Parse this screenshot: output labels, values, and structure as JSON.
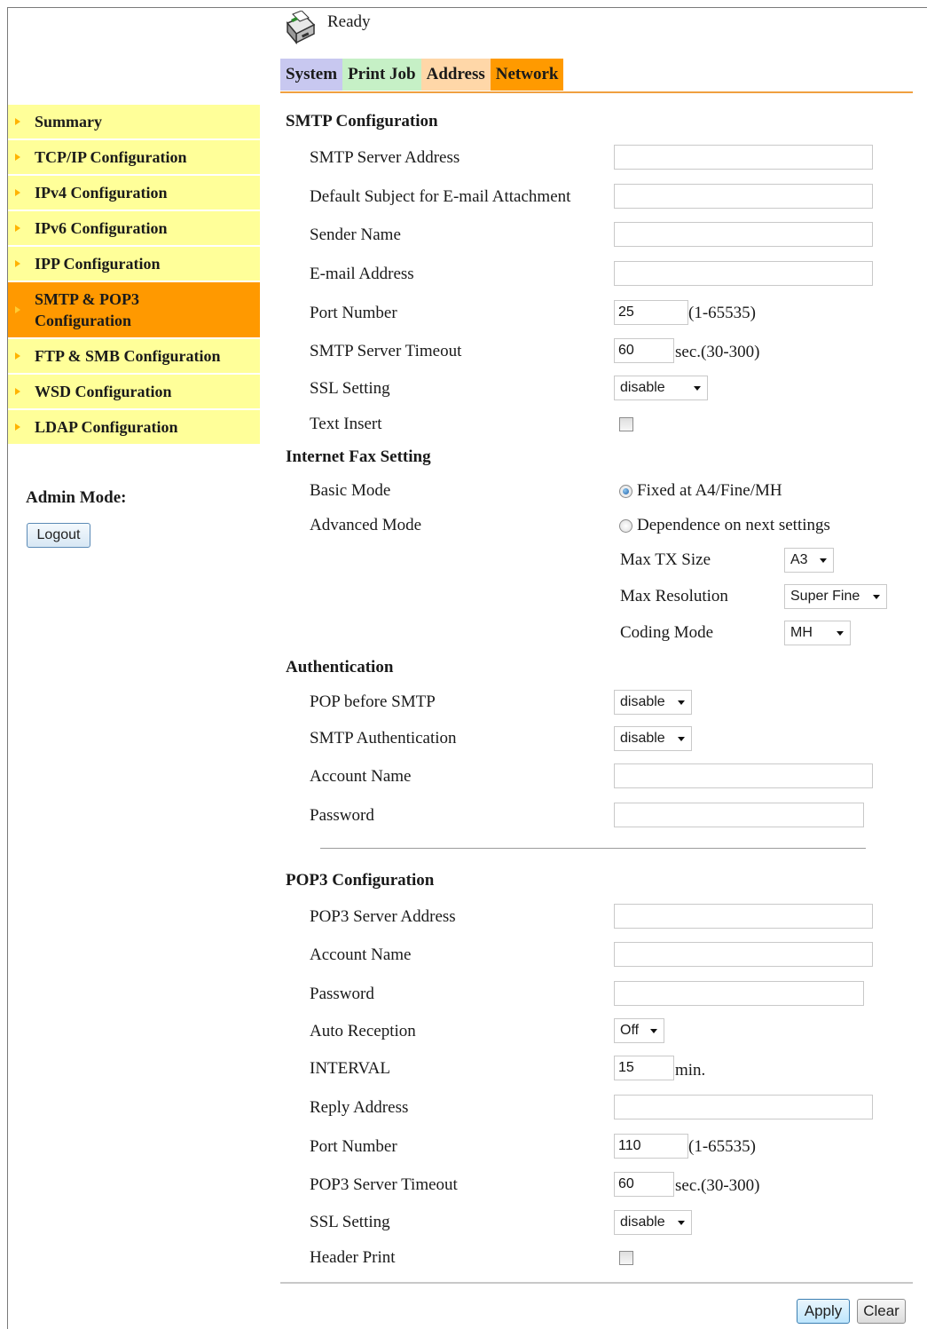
{
  "header": {
    "printer_icon": "printer-icon",
    "status": "Ready",
    "tabs": [
      "System",
      "Print Job",
      "Address",
      "Network"
    ],
    "active_tab": "Network",
    "colors": {
      "system": "#c8c8f0",
      "print_job": "#c6f0c6",
      "address": "#ffd7a8",
      "network": "#ff9a00"
    }
  },
  "sidebar": {
    "items": [
      {
        "label": "Summary"
      },
      {
        "label": "TCP/IP Configuration"
      },
      {
        "label": "IPv4 Configuration"
      },
      {
        "label": "IPv6 Configuration"
      },
      {
        "label": "IPP Configuration"
      },
      {
        "label": "SMTP & POP3 Configuration",
        "active": true
      },
      {
        "label": "FTP & SMB Configuration"
      },
      {
        "label": "WSD Configuration"
      },
      {
        "label": "LDAP Configuration"
      }
    ],
    "admin_label": "Admin Mode:",
    "logout_label": "Logout"
  },
  "smtp": {
    "title": "SMTP Configuration",
    "server_address_label": "SMTP Server Address",
    "server_address_value": "",
    "default_subject_label": "Default Subject for E-mail Attachment",
    "default_subject_value": "",
    "sender_name_label": "Sender Name",
    "sender_name_value": "",
    "email_address_label": "E-mail Address",
    "email_address_value": "",
    "port_number_label": "Port Number",
    "port_number_value": "25",
    "port_range": "(1-65535)",
    "timeout_label": "SMTP Server Timeout",
    "timeout_value": "60",
    "timeout_range": "sec.(30-300)",
    "ssl_label": "SSL Setting",
    "ssl_value": "disable",
    "text_insert_label": "Text Insert",
    "text_insert_checked": false
  },
  "ifax": {
    "title": "Internet Fax Setting",
    "basic_mode_label": "Basic Mode",
    "basic_mode_option": "Fixed at A4/Fine/MH",
    "advanced_mode_label": "Advanced Mode",
    "advanced_mode_option": "Dependence on next settings",
    "selected_mode": "basic",
    "max_tx_size_label": "Max TX Size",
    "max_tx_size_value": "A3",
    "max_resolution_label": "Max Resolution",
    "max_resolution_value": "Super Fine",
    "coding_mode_label": "Coding Mode",
    "coding_mode_value": "MH"
  },
  "auth": {
    "title": "Authentication",
    "pop_before_smtp_label": "POP before SMTP",
    "pop_before_smtp_value": "disable",
    "smtp_auth_label": "SMTP Authentication",
    "smtp_auth_value": "disable",
    "account_name_label": "Account Name",
    "account_name_value": "",
    "password_label": "Password",
    "password_value": ""
  },
  "pop3": {
    "title": "POP3 Configuration",
    "server_address_label": "POP3 Server Address",
    "server_address_value": "",
    "account_name_label": "Account Name",
    "account_name_value": "",
    "password_label": "Password",
    "password_value": "",
    "auto_reception_label": "Auto Reception",
    "auto_reception_value": "Off",
    "interval_label": "INTERVAL",
    "interval_value": "15",
    "interval_unit": "min.",
    "reply_address_label": "Reply Address",
    "reply_address_value": "",
    "port_number_label": "Port Number",
    "port_number_value": "110",
    "port_range": "(1-65535)",
    "timeout_label": "POP3 Server Timeout",
    "timeout_value": "60",
    "timeout_range": "sec.(30-300)",
    "ssl_label": "SSL Setting",
    "ssl_value": "disable",
    "header_print_label": "Header Print",
    "header_print_checked": false
  },
  "actions": {
    "apply_label": "Apply",
    "clear_label": "Clear"
  }
}
